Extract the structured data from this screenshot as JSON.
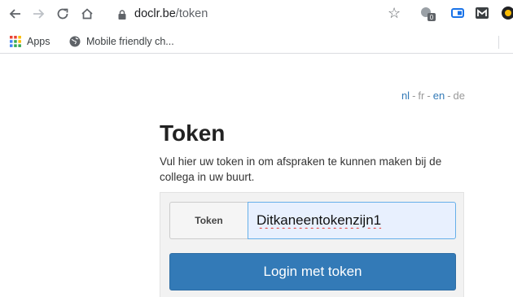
{
  "browser": {
    "url_host": "doclr.be",
    "url_path": "/token",
    "nav_icons": [
      "back-arrow-icon",
      "forward-arrow-icon",
      "reload-icon",
      "home-icon"
    ],
    "extension_badge": "0"
  },
  "bookmarks": {
    "items": [
      {
        "label": "Apps",
        "icon": "apps-grid-icon"
      },
      {
        "label": "Mobile friendly ch...",
        "icon": "globe-icon"
      }
    ]
  },
  "languages": [
    {
      "code": "nl",
      "active": true
    },
    {
      "code": "fr",
      "active": false
    },
    {
      "code": "en",
      "active": true
    },
    {
      "code": "de",
      "active": false
    }
  ],
  "language_separator": "-",
  "page": {
    "title": "Token",
    "intro": "Vul hier uw token in om afspraken te kunnen maken bij de collega in uw buurt."
  },
  "form": {
    "token_label": "Token",
    "token_value": "Ditkaneentokenzijn1",
    "submit_label": "Login met token"
  },
  "colors": {
    "primary": "#337ab7",
    "link_inactive": "#999999",
    "input_autofill": "#e8f0fe"
  }
}
